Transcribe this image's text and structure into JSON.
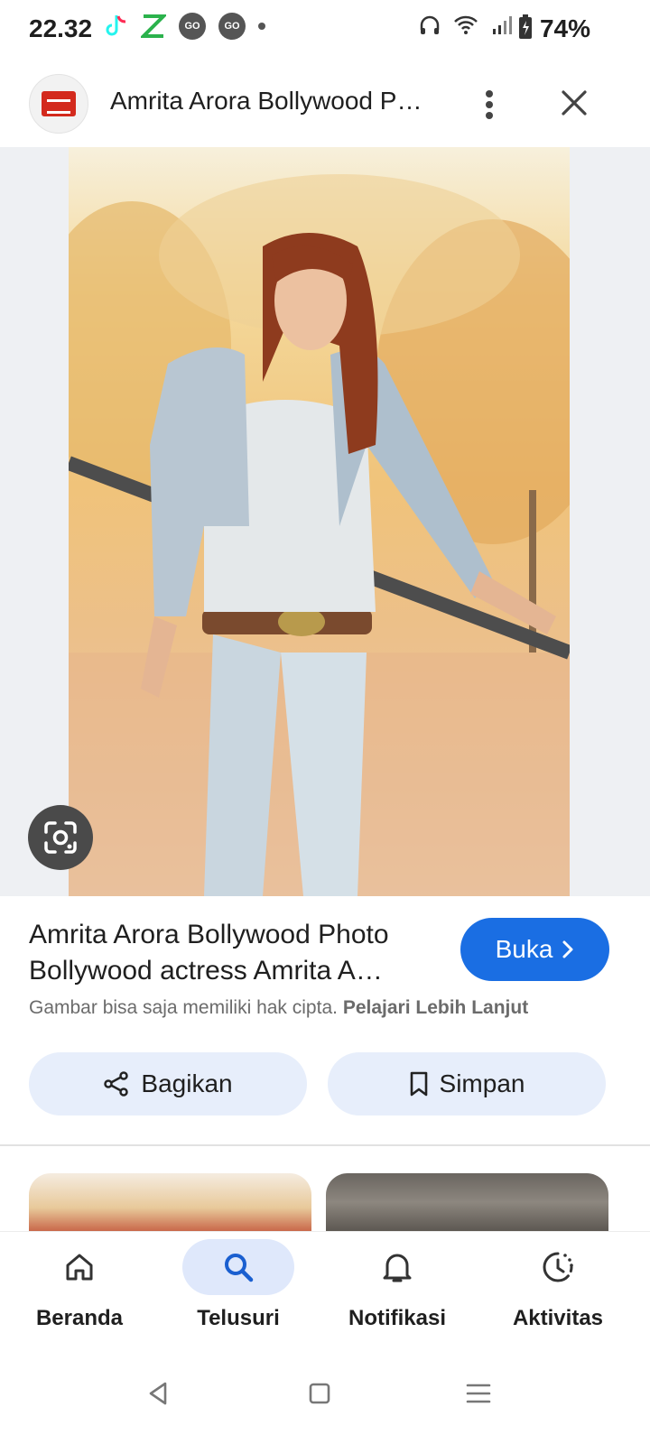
{
  "status_bar": {
    "time": "22.32",
    "battery": "74%",
    "icons": [
      "tiktok-icon",
      "x-app-icon",
      "go-badge-icon",
      "go-badge-icon",
      "notification-dot",
      "headphones-icon",
      "wifi-icon",
      "signal-icon",
      "battery-icon"
    ],
    "go_label": "GO"
  },
  "header": {
    "title": "Amrita Arora Bollywood P…",
    "logo_color": "#d32a1d"
  },
  "image": {
    "lens_icon": "google-lens-icon"
  },
  "result": {
    "title_line1": "Amrita Arora Bollywood Photo",
    "title_line2": "Bollywood actress Amrita A…",
    "open_label": "Buka",
    "copyright_text": "Gambar bisa saja memiliki hak cipta.",
    "learn_more": "Pelajari Lebih Lanjut",
    "accent": "#1a6ee3"
  },
  "actions": {
    "share_label": "Bagikan",
    "save_label": "Simpan"
  },
  "bottom_nav": {
    "items": [
      {
        "label": "Beranda",
        "icon": "home-icon"
      },
      {
        "label": "Telusuri",
        "icon": "search-icon"
      },
      {
        "label": "Notifikasi",
        "icon": "bell-icon"
      },
      {
        "label": "Aktivitas",
        "icon": "activity-icon"
      }
    ],
    "active": "Telusuri"
  }
}
